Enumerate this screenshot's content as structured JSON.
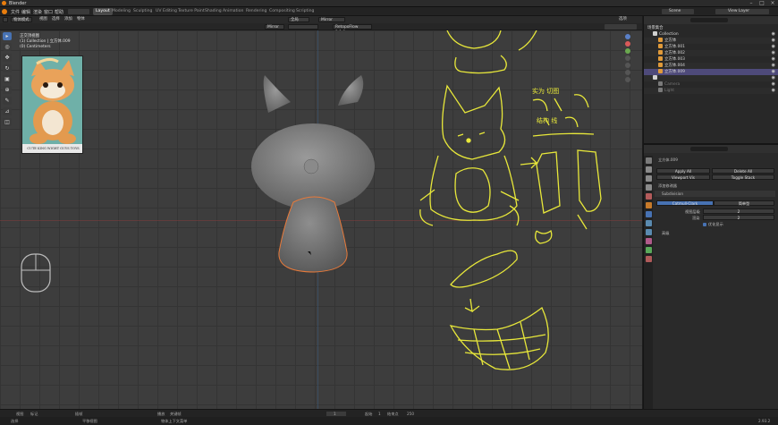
{
  "window": {
    "title": "Blender"
  },
  "menu": {
    "items": [
      "文件",
      "编辑",
      "渲染",
      "窗口",
      "帮助"
    ]
  },
  "workspaces": {
    "tabs": [
      "Layout",
      "Modeling",
      "Sculpting",
      "UV Editing",
      "Texture Paint",
      "Shading",
      "Animation",
      "Rendering",
      "Compositing",
      "Scripting"
    ],
    "active": "Layout"
  },
  "scene": {
    "name": "Scene",
    "view_layer": "View Layer"
  },
  "viewport_header": {
    "mode": "物体模式",
    "view": "视图",
    "select": "选择",
    "add": "添加",
    "object": "物体",
    "orientation": "全局",
    "snap": "Mirror",
    "addon": "RetopoFlow 3.1.0",
    "options": "选项"
  },
  "viewport_info": {
    "line1": "正交顶视图",
    "line2": "(1) Collection | 立方体.009",
    "line3": "(0) Centimeters"
  },
  "reference_image": {
    "caption": "CUTE KING WIGHT GUYS TOYS"
  },
  "outliner": {
    "title": "场景集合",
    "rows": [
      {
        "label": "Collection",
        "indent": 1,
        "icon": "collection-icon"
      },
      {
        "label": "立方体",
        "indent": 2,
        "icon": "mesh-icon"
      },
      {
        "label": "立方体.001",
        "indent": 2,
        "icon": "mesh-icon"
      },
      {
        "label": "立方体.002",
        "indent": 2,
        "icon": "mesh-icon"
      },
      {
        "label": "立方体.003",
        "indent": 2,
        "icon": "mesh-icon"
      },
      {
        "label": "立方体.004",
        "indent": 2,
        "icon": "mesh-icon"
      },
      {
        "label": "立方体.009",
        "indent": 2,
        "icon": "mesh-icon",
        "selected": true
      },
      {
        "label": "",
        "indent": 1,
        "icon": "collection-icon"
      },
      {
        "label": "Camera",
        "indent": 2,
        "icon": "camera-icon",
        "dim": true
      },
      {
        "label": "Light",
        "indent": 2,
        "icon": "light-icon",
        "dim": true
      }
    ]
  },
  "properties": {
    "object_name": "立方体.009",
    "add_modifier": "添加修改器",
    "buttons": [
      "Apply All",
      "Delete All",
      "Viewport Vis",
      "Toggle Stack"
    ],
    "modifier": {
      "name": "Subdivision",
      "tab1": "Catmull-Clark",
      "tab2": "简单型",
      "fields": [
        {
          "label": "视图层级",
          "value": "2"
        },
        {
          "label": "渲染",
          "value": "2"
        }
      ],
      "checkbox": "优化显示",
      "advanced": "高级"
    }
  },
  "annotations": {
    "title": "实为 切图",
    "subtitle": "结构 线"
  },
  "statusbar": {
    "left": "选择",
    "mid": "平移视图",
    "right": "物体上下文菜单",
    "version": "2.93.2"
  },
  "bottombar": {
    "items": [
      "视图",
      "标记",
      "播放",
      "插帧",
      "关键帧"
    ],
    "frame": "1",
    "start_label": "起始",
    "start": "1",
    "end_label": "结束点",
    "end": "250"
  },
  "colors": {
    "accent": "#4772b3",
    "annotation": "#e8e83a",
    "selection_outline": "#e87a3a",
    "selected_row": "#4e4a7a"
  }
}
